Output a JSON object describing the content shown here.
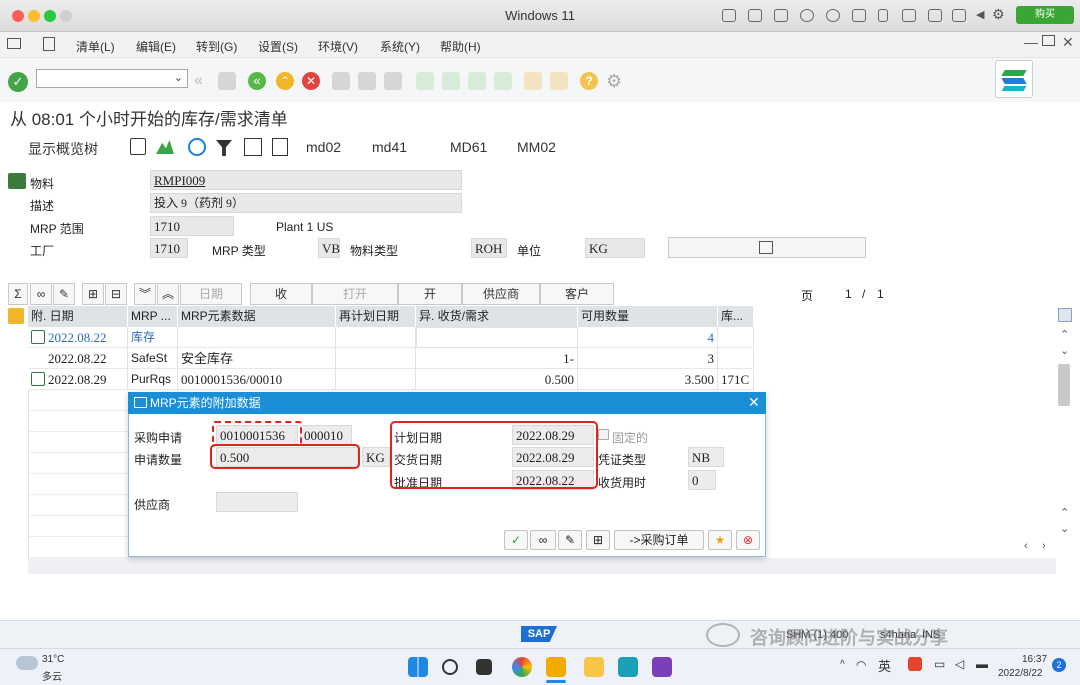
{
  "mac": {
    "title": "Windows 11",
    "buy_label": "购买"
  },
  "menu": {
    "items": [
      "清单(L)",
      "编辑(E)",
      "转到(G)",
      "设置(S)",
      "环境(V)",
      "系统(Y)",
      "帮助(H)"
    ]
  },
  "page": {
    "title": "从 08:01 个小时开始的库存/需求清单"
  },
  "apptool": {
    "overview": "显示概览树",
    "md02": "md02",
    "md41": "md41",
    "md61": "MD61",
    "mm02": "MM02"
  },
  "header": {
    "material_label": "物料",
    "material_value": "RMPI009",
    "desc_label": "描述",
    "desc_value": "投入 9（药剂 9）",
    "mrp_area_label": "MRP 范围",
    "mrp_area_value": "1710",
    "mrp_area_text": "Plant 1 US",
    "plant_label": "工厂",
    "plant_value": "1710",
    "mrp_type_label": "MRP 类型",
    "mrp_type_value": "VB",
    "mat_type_label": "物料类型",
    "mat_type_value": "ROH",
    "unit_label": "单位",
    "unit_value": "KG"
  },
  "gridbar": {
    "sigma": "Σ",
    "date_label": "日期",
    "receive_label": "收",
    "open_label": "打开",
    "open2_label": "开",
    "vendor_label": "供应商",
    "customer_label": "客户",
    "page_label": "页",
    "page_cur": "1",
    "page_sep": "/",
    "page_total": "1"
  },
  "table": {
    "headers": [
      "附. 日期",
      "MRP ...",
      "MRP元素数据",
      "再计划日期",
      "异. 收货/需求",
      "可用数量",
      "库..."
    ],
    "rows": [
      {
        "date": "2022.08.22",
        "mrp": "库存",
        "data": "",
        "replan": "",
        "qty": "",
        "avail": "4",
        "stor": ""
      },
      {
        "date": "2022.08.22",
        "mrp": "SafeSt",
        "data": "安全库存",
        "replan": "",
        "qty": "1-",
        "avail": "3",
        "stor": ""
      },
      {
        "date": "2022.08.29",
        "mrp": "PurRqs",
        "data": "0010001536/00010",
        "replan": "",
        "qty": "0.500",
        "avail": "3.500",
        "stor": "171C"
      }
    ]
  },
  "dialog": {
    "title": "MRP元素的附加数据",
    "pr_label": "采购申请",
    "pr_number": "0010001536",
    "pr_item": "000010",
    "qty_label": "申请数量",
    "qty_value": "0.500",
    "qty_unit": "KG",
    "plan_date_label": "计划日期",
    "plan_date": "2022.08.29",
    "fixed_label": "固定的",
    "delivery_date_label": "交货日期",
    "delivery_date": "2022.08.29",
    "doc_type_label": "凭证类型",
    "doc_type": "NB",
    "release_date_label": "批准日期",
    "release_date": "2022.08.22",
    "gr_time_label": "收货用时",
    "gr_time": "0",
    "vendor_label": "供应商",
    "po_button": "->采购订单"
  },
  "status": {
    "sap": "SAP",
    "watermark": "咨询顾问进阶与实战分享",
    "sys_text": "SHM (1) 400",
    "host": "s4hana",
    "mode": "INS"
  },
  "taskbar": {
    "temp": "31°C",
    "weather": "多云",
    "time": "16:37",
    "date": "2022/8/22",
    "ime": "英",
    "notif": "2"
  }
}
